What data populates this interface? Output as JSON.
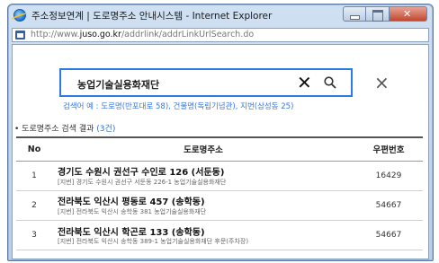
{
  "window": {
    "title": "주소정보연계 | 도로명주소 안내시스템 - Internet Explorer",
    "url_prefix": "http://www.",
    "url_domain": "juso.go.kr",
    "url_path": "/addrlink/addrLinkUrlSearch.do"
  },
  "search": {
    "query": "농업기술실용화재단",
    "example": "검색어 예 : 도로명(반포대로 58), 건물명(독립기념관), 지번(삼성동 25)"
  },
  "results": {
    "label_prefix": "• 도로명주소 검색 결과",
    "label_count": "(3건)",
    "headers": {
      "no": "No",
      "address": "도로명주소",
      "zip": "우편번호"
    },
    "rows": [
      {
        "no": "1",
        "road": "경기도 수원시 권선구 수인로 126 (서둔동)",
        "jibun": "[지번] 경기도 수원시 권선구 서둔동 226-1 농업기술실용화재단",
        "zip": "16429"
      },
      {
        "no": "2",
        "road": "전라북도 익산시 평동로 457 (송학동)",
        "jibun": "[지번] 전라북도 익산시 송학동 381 농업기술실용화재단",
        "zip": "54667"
      },
      {
        "no": "3",
        "road": "전라북도 익산시 학곤로 133 (송학동)",
        "jibun": "[지번] 전라북도 익산시 송학동 389-1 농업기술실용화재단 후문(주차장)",
        "zip": "54667"
      }
    ]
  }
}
